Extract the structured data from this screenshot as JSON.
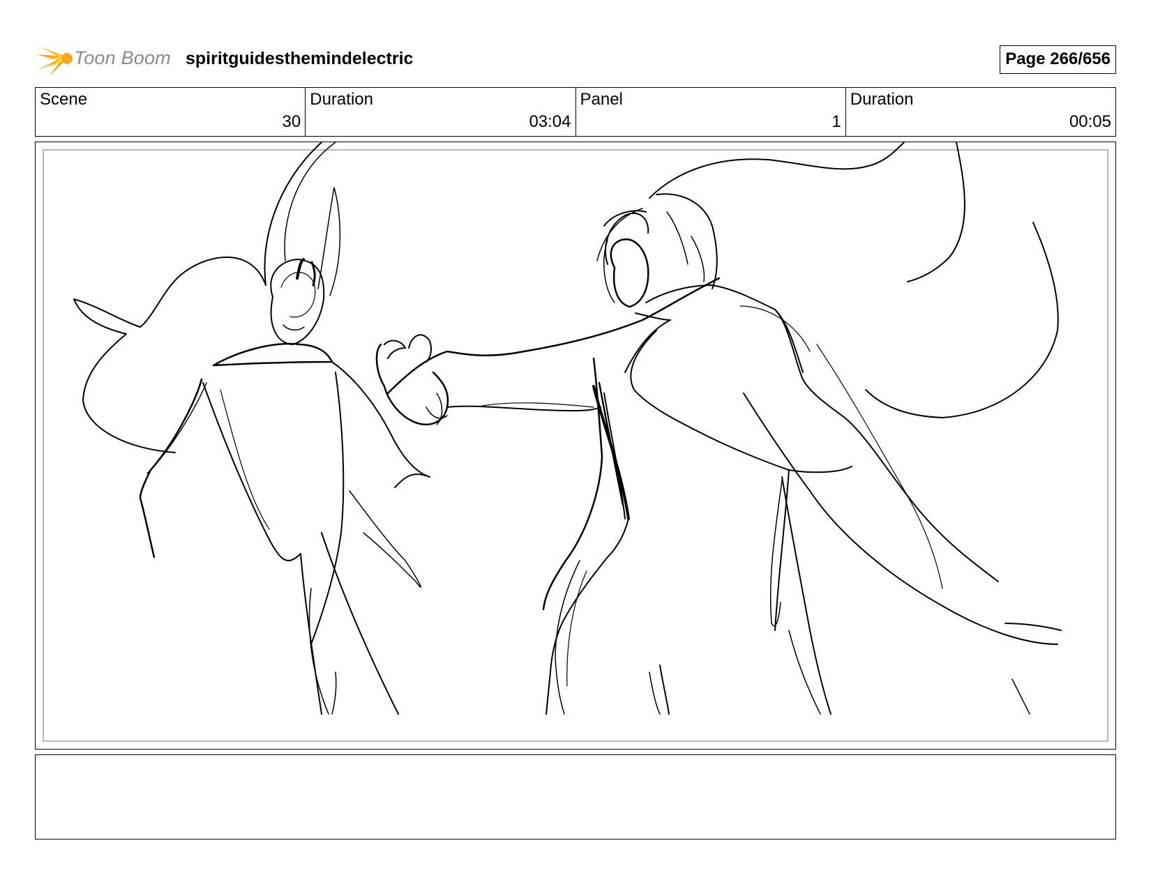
{
  "header": {
    "logo_text": "Toon Boom",
    "project_title": "spiritguidesthemindelectric",
    "page_label": "Page 266/656"
  },
  "info": {
    "scene_label": "Scene",
    "scene_value": "30",
    "scene_duration_label": "Duration",
    "scene_duration_value": "03:04",
    "panel_label": "Panel",
    "panel_value": "1",
    "panel_duration_label": "Duration",
    "panel_duration_value": "00:05"
  },
  "notes": {
    "text": ""
  },
  "colors": {
    "logo_orange": "#f5a623",
    "logo_yellow": "#ffd23f",
    "logo_text_gray": "#8a8a8a",
    "frame_gray": "#b8b8b8"
  }
}
